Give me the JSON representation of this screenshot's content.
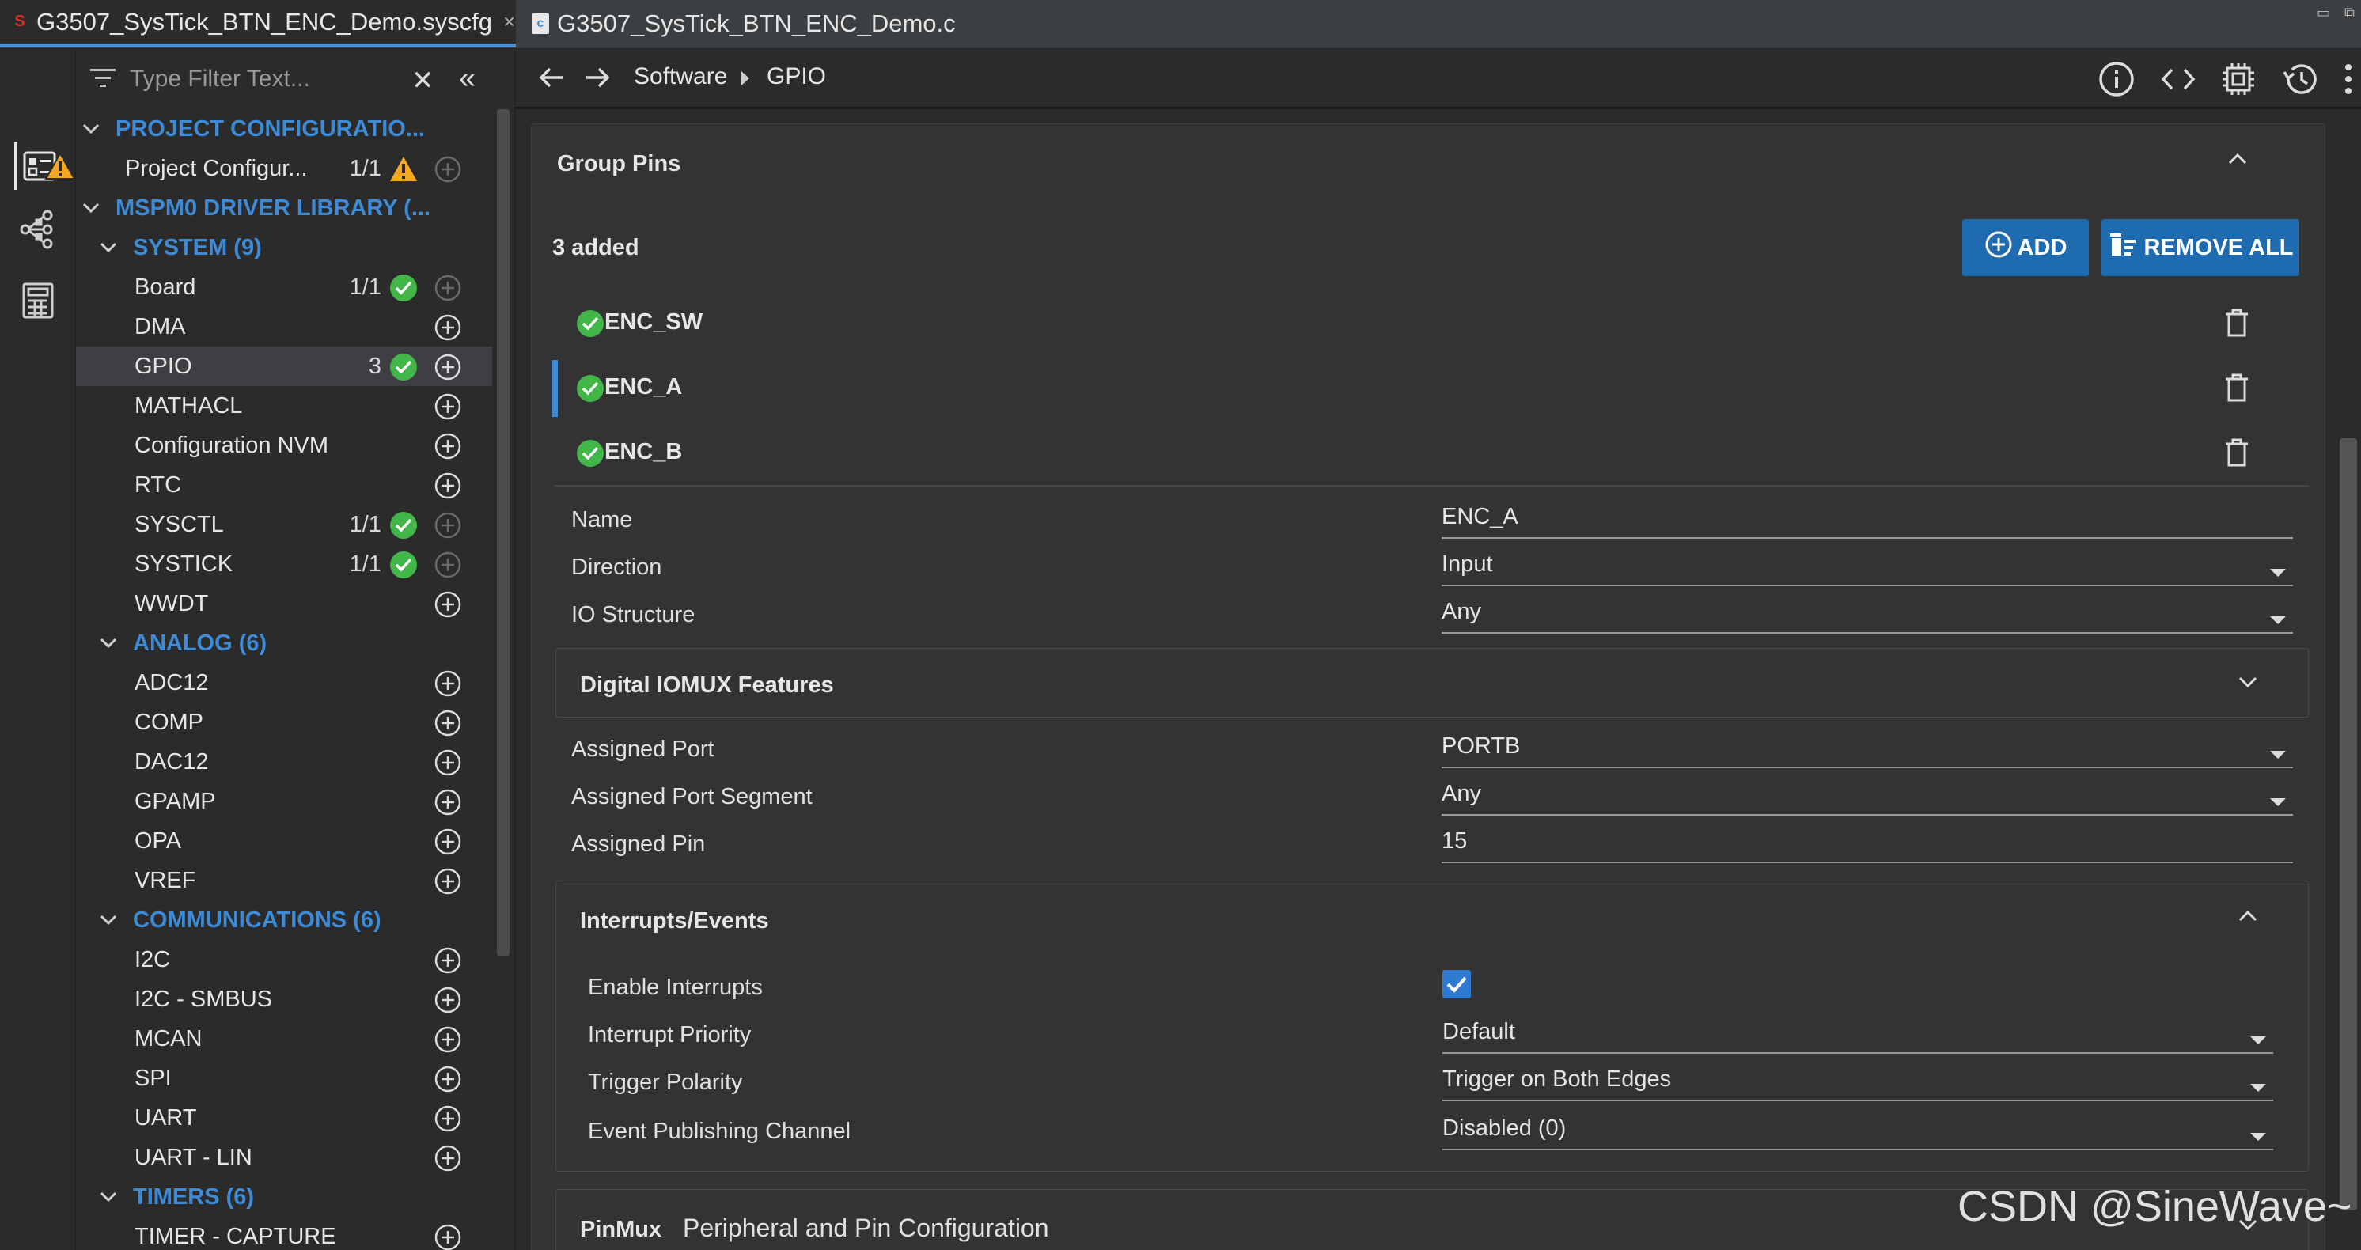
{
  "tabs": [
    {
      "label": "G3507_SysTick_BTN_ENC_Demo.syscfg",
      "active": true
    },
    {
      "label": "G3507_SysTick_BTN_ENC_Demo.c",
      "active": false
    }
  ],
  "activity": {
    "icons": [
      "config-icon",
      "tree-icon",
      "calculator-icon"
    ]
  },
  "filter": {
    "placeholder": "Type Filter Text...",
    "value": ""
  },
  "tree": {
    "project_configuration": {
      "label": "PROJECT CONFIGURATIO..."
    },
    "project_config_item": {
      "label": "Project Configur...",
      "count": "1/1",
      "status": "warning"
    },
    "driver_library": {
      "label": "MSPM0 DRIVER LIBRARY (..."
    },
    "system": {
      "label": "SYSTEM (9)",
      "items": [
        {
          "label": "Board",
          "count": "1/1",
          "status": "ok"
        },
        {
          "label": "DMA",
          "count": "",
          "status": ""
        },
        {
          "label": "GPIO",
          "count": "3",
          "status": "ok",
          "selected": true
        },
        {
          "label": "MATHACL",
          "count": "",
          "status": ""
        },
        {
          "label": "Configuration NVM",
          "count": "",
          "status": ""
        },
        {
          "label": "RTC",
          "count": "",
          "status": ""
        },
        {
          "label": "SYSCTL",
          "count": "1/1",
          "status": "ok"
        },
        {
          "label": "SYSTICK",
          "count": "1/1",
          "status": "ok"
        },
        {
          "label": "WWDT",
          "count": "",
          "status": ""
        }
      ]
    },
    "analog": {
      "label": "ANALOG (6)",
      "items": [
        {
          "label": "ADC12"
        },
        {
          "label": "COMP"
        },
        {
          "label": "DAC12"
        },
        {
          "label": "GPAMP"
        },
        {
          "label": "OPA"
        },
        {
          "label": "VREF"
        }
      ]
    },
    "communications": {
      "label": "COMMUNICATIONS (6)",
      "items": [
        {
          "label": "I2C"
        },
        {
          "label": "I2C - SMBUS"
        },
        {
          "label": "MCAN"
        },
        {
          "label": "SPI"
        },
        {
          "label": "UART"
        },
        {
          "label": "UART - LIN"
        }
      ]
    },
    "timers": {
      "label": "TIMERS (6)",
      "items": [
        {
          "label": "TIMER - CAPTURE"
        }
      ]
    }
  },
  "breadcrumb": {
    "items": [
      "Software",
      "GPIO"
    ]
  },
  "toolbar": {
    "icons": [
      "info-icon",
      "code-icon",
      "chip-icon",
      "history-icon",
      "more-vertical-icon"
    ]
  },
  "group_pins": {
    "title": "Group Pins",
    "added_count": "3 added",
    "add_label": "ADD",
    "remove_all_label": "REMOVE ALL",
    "pins": [
      {
        "name": "ENC_SW",
        "status": "ok",
        "selected": false
      },
      {
        "name": "ENC_A",
        "status": "ok",
        "selected": true
      },
      {
        "name": "ENC_B",
        "status": "ok",
        "selected": false
      }
    ]
  },
  "properties": {
    "name": {
      "label": "Name",
      "value": "ENC_A"
    },
    "direction": {
      "label": "Direction",
      "value": "Input"
    },
    "io_structure": {
      "label": "IO Structure",
      "value": "Any"
    }
  },
  "digital_iomux": {
    "title": "Digital IOMUX Features",
    "expanded": false
  },
  "assigned": {
    "port": {
      "label": "Assigned Port",
      "value": "PORTB"
    },
    "port_segment": {
      "label": "Assigned Port Segment",
      "value": "Any"
    },
    "pin": {
      "label": "Assigned Pin",
      "value": "15"
    }
  },
  "interrupts": {
    "title": "Interrupts/Events",
    "expanded": true,
    "enable": {
      "label": "Enable Interrupts",
      "checked": true
    },
    "priority": {
      "label": "Interrupt Priority",
      "value": "Default"
    },
    "polarity": {
      "label": "Trigger Polarity",
      "value": "Trigger on Both Edges"
    },
    "event_channel": {
      "label": "Event Publishing Channel",
      "value": "Disabled (0)"
    }
  },
  "pinmux": {
    "title": "PinMux",
    "subtitle": "Peripheral and Pin Configuration"
  },
  "watermark": "CSDN @SineWave~",
  "colors": {
    "accent": "#3d8bd6",
    "ok": "#43b649",
    "warning": "#f5a623",
    "button": "#1e6bb0"
  }
}
